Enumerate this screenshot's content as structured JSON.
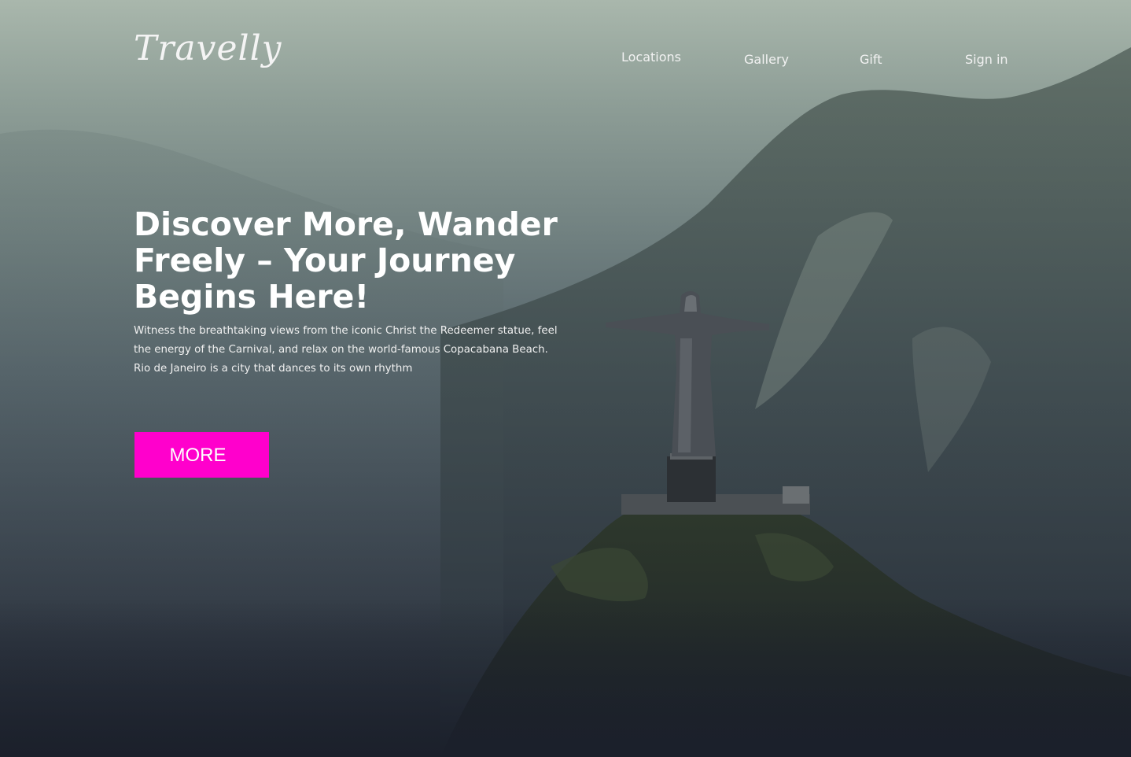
{
  "brand": {
    "logo_text": "Travelly"
  },
  "nav": {
    "locations": "Locations",
    "gallery": "Gallery",
    "gift": "Gift",
    "sign_in": "Sign in"
  },
  "hero": {
    "title": "Discover More, Wander Freely – Your Journey Begins Here!",
    "description": "Witness the breathtaking views from the iconic Christ the Redeemer statue, feel the energy of the Carnival, and relax on the world-famous Copacabana Beach. Rio de Janeiro is a city that dances to its own rhythm",
    "cta_label": "MORE"
  },
  "colors": {
    "accent": "#ff00cc",
    "text": "#ffffff",
    "background_dark": "#1b202b"
  }
}
